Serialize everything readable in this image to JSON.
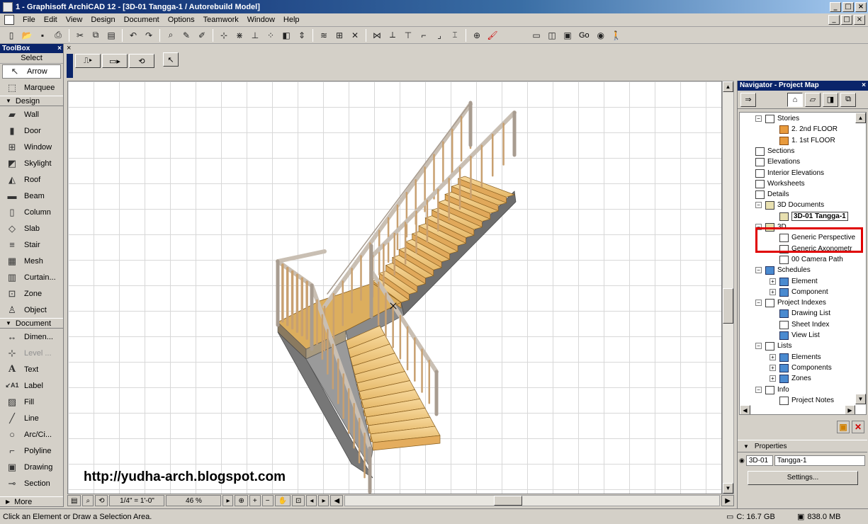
{
  "window": {
    "title": "1 - Graphisoft ArchiCAD 12 - [3D-01 Tangga-1 / Autorebuild Model]",
    "minimize": "_",
    "maximize": "□",
    "close": "×"
  },
  "menu": [
    "File",
    "Edit",
    "View",
    "Design",
    "Document",
    "Options",
    "Teamwork",
    "Window",
    "Help"
  ],
  "toolbar": {
    "go_label": "Go"
  },
  "toolbox": {
    "title": "ToolBox",
    "close": "×",
    "select_header": "Select",
    "select_tools": [
      {
        "label": "Arrow",
        "icon": "arrow-icon"
      },
      {
        "label": "Marquee",
        "icon": "marquee-icon"
      }
    ],
    "design_header": "Design",
    "design_tools": [
      {
        "label": "Wall",
        "icon": "wall-icon"
      },
      {
        "label": "Door",
        "icon": "door-icon"
      },
      {
        "label": "Window",
        "icon": "window-icon"
      },
      {
        "label": "Skylight",
        "icon": "skylight-icon"
      },
      {
        "label": "Roof",
        "icon": "roof-icon"
      },
      {
        "label": "Beam",
        "icon": "beam-icon"
      },
      {
        "label": "Column",
        "icon": "column-icon"
      },
      {
        "label": "Slab",
        "icon": "slab-icon"
      },
      {
        "label": "Stair",
        "icon": "stair-icon"
      },
      {
        "label": "Mesh",
        "icon": "mesh-icon"
      },
      {
        "label": "Curtain...",
        "icon": "curtain-wall-icon"
      },
      {
        "label": "Zone",
        "icon": "zone-icon"
      },
      {
        "label": "Object",
        "icon": "object-icon"
      }
    ],
    "document_header": "Document",
    "document_tools": [
      {
        "label": "Dimen...",
        "icon": "dimension-icon"
      },
      {
        "label": "Level ...",
        "icon": "level-dimension-icon"
      },
      {
        "label": "Text",
        "icon": "text-icon"
      },
      {
        "label": "Label",
        "icon": "label-icon"
      },
      {
        "label": "Fill",
        "icon": "fill-icon"
      },
      {
        "label": "Line",
        "icon": "line-icon"
      },
      {
        "label": "Arc/Ci...",
        "icon": "arc-circle-icon"
      },
      {
        "label": "Polyline",
        "icon": "polyline-icon"
      },
      {
        "label": "Drawing",
        "icon": "drawing-icon"
      },
      {
        "label": "Section",
        "icon": "section-icon"
      }
    ],
    "more_label": "More"
  },
  "canvas": {
    "watermark": "http://yudha-arch.blogspot.com"
  },
  "bottombar": {
    "scale": "1/4\"  =  1'-0\"",
    "zoom": "46 %"
  },
  "statusbar": {
    "message": "Click an Element or Draw a Selection Area.",
    "disk": "C: 16.7 GB",
    "memory": "838.0 MB"
  },
  "navigator": {
    "title": "Navigator - Project Map",
    "close": "×",
    "tree": [
      {
        "label": "Stories",
        "level": 0,
        "expander": "−",
        "icon": "stories-icon"
      },
      {
        "label": "2. 2nd FLOOR",
        "level": 1,
        "icon": "story-icon"
      },
      {
        "label": "1. 1st FLOOR",
        "level": 1,
        "icon": "story-icon"
      },
      {
        "label": "Sections",
        "level": 0,
        "icon": "sections-icon"
      },
      {
        "label": "Elevations",
        "level": 0,
        "icon": "elevations-icon"
      },
      {
        "label": "Interior Elevations",
        "level": 0,
        "icon": "interior-elevations-icon"
      },
      {
        "label": "Worksheets",
        "level": 0,
        "icon": "worksheets-icon"
      },
      {
        "label": "Details",
        "level": 0,
        "icon": "details-icon"
      },
      {
        "label": "3D Documents",
        "level": 0,
        "expander": "−",
        "icon": "3d-documents-icon"
      },
      {
        "label": "3D-01 Tangga-1",
        "level": 1,
        "icon": "3d-document-icon",
        "selected": true
      },
      {
        "label": "3D",
        "level": 0,
        "expander": "−",
        "icon": "3d-icon"
      },
      {
        "label": "Generic Perspective",
        "level": 1,
        "icon": "perspective-icon"
      },
      {
        "label": "Generic Axonometr",
        "level": 1,
        "icon": "axonometry-icon"
      },
      {
        "label": "00 Camera Path",
        "level": 1,
        "icon": "camera-path-icon"
      },
      {
        "label": "Schedules",
        "level": 0,
        "expander": "−",
        "icon": "schedules-icon"
      },
      {
        "label": "Element",
        "level": 1,
        "expander": "+",
        "icon": "element-schedule-icon"
      },
      {
        "label": "Component",
        "level": 1,
        "expander": "+",
        "icon": "component-schedule-icon"
      },
      {
        "label": "Project Indexes",
        "level": 0,
        "expander": "−",
        "icon": "project-indexes-icon"
      },
      {
        "label": "Drawing List",
        "level": 1,
        "icon": "drawing-list-icon"
      },
      {
        "label": "Sheet Index",
        "level": 1,
        "icon": "sheet-index-icon"
      },
      {
        "label": "View List",
        "level": 1,
        "icon": "view-list-icon"
      },
      {
        "label": "Lists",
        "level": 0,
        "expander": "−",
        "icon": "lists-icon"
      },
      {
        "label": "Elements",
        "level": 1,
        "expander": "+",
        "icon": "elements-list-icon"
      },
      {
        "label": "Components",
        "level": 1,
        "expander": "+",
        "icon": "components-list-icon"
      },
      {
        "label": "Zones",
        "level": 1,
        "expander": "+",
        "icon": "zones-list-icon"
      },
      {
        "label": "Info",
        "level": 0,
        "expander": "−",
        "icon": "info-icon"
      },
      {
        "label": "Project Notes",
        "level": 1,
        "icon": "project-notes-icon"
      }
    ],
    "properties_label": "Properties",
    "prop_id": "3D-01",
    "prop_name": "Tangga-1",
    "settings_label": "Settings..."
  }
}
